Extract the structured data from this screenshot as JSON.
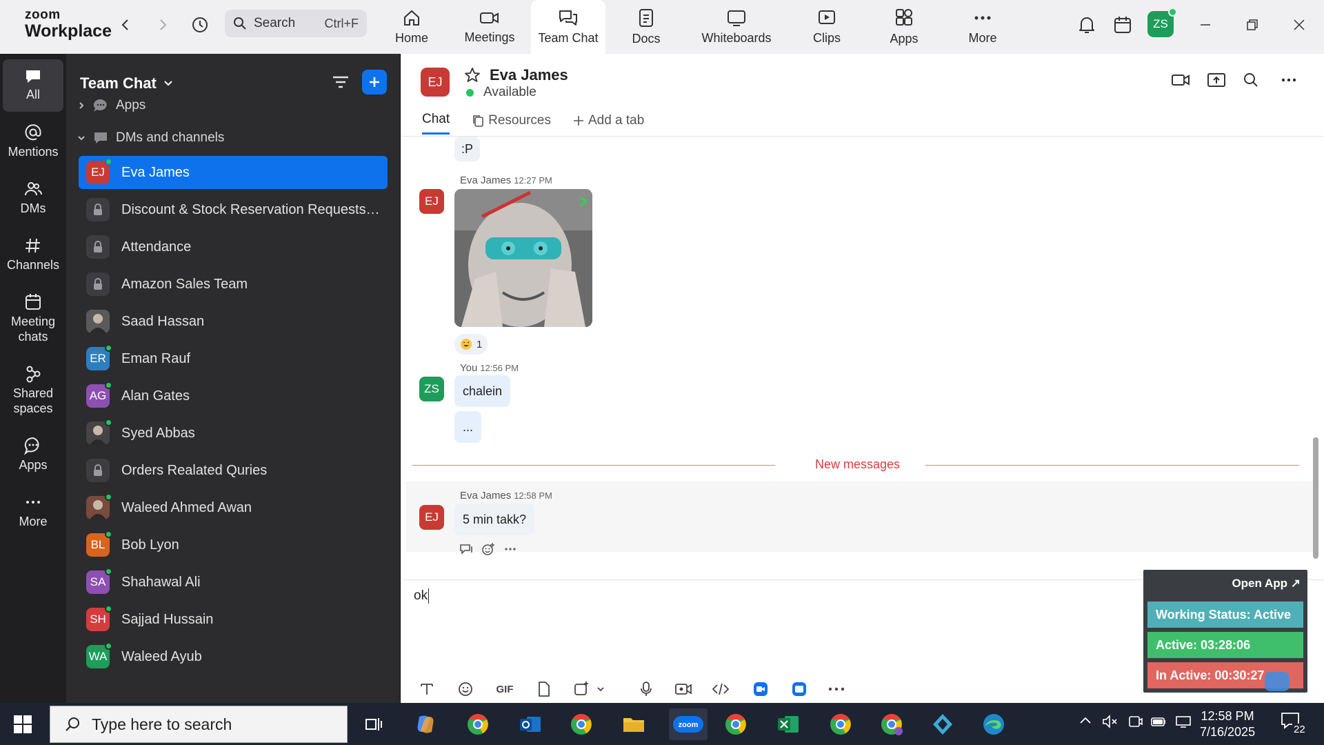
{
  "app": {
    "logo_line1": "zoom",
    "logo_line2": "Workplace",
    "search_placeholder": "Search",
    "search_shortcut": "Ctrl+F",
    "avatar_initials": "ZS"
  },
  "nav": [
    {
      "label": "Home",
      "icon": "home-icon"
    },
    {
      "label": "Meetings",
      "icon": "video-camera-icon"
    },
    {
      "label": "Team Chat",
      "icon": "chat-bubbles-icon",
      "active": true
    },
    {
      "label": "Docs",
      "icon": "document-icon"
    },
    {
      "label": "Whiteboards",
      "icon": "whiteboard-icon"
    },
    {
      "label": "Clips",
      "icon": "clips-icon"
    },
    {
      "label": "Apps",
      "icon": "apps-icon"
    },
    {
      "label": "More",
      "icon": "more-icon"
    }
  ],
  "rail": [
    {
      "label": "All",
      "icon": "chat-icon",
      "active": true
    },
    {
      "label": "Mentions",
      "icon": "at-icon"
    },
    {
      "label": "DMs",
      "icon": "people-icon"
    },
    {
      "label": "Channels",
      "icon": "hashtag-icon"
    },
    {
      "label": "Meeting chats",
      "icon": "calendar-icon"
    },
    {
      "label": "Shared spaces",
      "icon": "shared-spaces-icon"
    },
    {
      "label": "Apps",
      "icon": "apps-chat-icon"
    },
    {
      "label": "More",
      "icon": "more-icon"
    }
  ],
  "list": {
    "title": "Team Chat",
    "sections": {
      "apps": "Apps",
      "dms": "DMs and channels"
    },
    "items": [
      {
        "name": "Eva James",
        "type": "avatar",
        "initials": "EJ",
        "color": "#c83a34",
        "online": true,
        "active": true
      },
      {
        "name": "Discount & Stock Reservation Requests O...",
        "type": "lock"
      },
      {
        "name": "Attendance",
        "type": "lock"
      },
      {
        "name": "Amazon Sales Team",
        "type": "lock"
      },
      {
        "name": "Saad Hassan",
        "type": "photo",
        "color": "#5a5a5a",
        "online": false
      },
      {
        "name": "Eman Rauf",
        "type": "avatar",
        "initials": "ER",
        "color": "#2b7fc0",
        "online": true
      },
      {
        "name": "Alan Gates",
        "type": "avatar",
        "initials": "AG",
        "color": "#8e4fb3",
        "online": true
      },
      {
        "name": "Syed Abbas",
        "type": "photo",
        "color": "#444444",
        "online": true
      },
      {
        "name": "Orders Realated Quries",
        "type": "lock"
      },
      {
        "name": "Waleed Ahmed Awan",
        "type": "photo",
        "color": "#7a4b3c",
        "online": true
      },
      {
        "name": "Bob Lyon",
        "type": "avatar",
        "initials": "BL",
        "color": "#d9641e",
        "online": true
      },
      {
        "name": "Shahawal Ali",
        "type": "avatar",
        "initials": "SA",
        "color": "#8e4fb3",
        "online": true
      },
      {
        "name": "Sajjad Hussain",
        "type": "avatar",
        "initials": "SH",
        "color": "#d63c3c",
        "online": true
      },
      {
        "name": "Waleed Ayub",
        "type": "avatar",
        "initials": "WA",
        "color": "#1f9c5a",
        "online": true
      }
    ]
  },
  "chat": {
    "contact_initials": "EJ",
    "contact_name": "Eva James",
    "contact_status": "Available",
    "tabs": {
      "chat": "Chat",
      "resources": "Resources",
      "add": "Add a tab"
    },
    "messages": {
      "top_text": ":P",
      "gif_sender": "Eva James",
      "gif_time": "12:27 PM",
      "reaction_count": "1",
      "you_initials": "ZS",
      "you_sender": "You",
      "you_time": "12:56 PM",
      "you_text1": "chalein",
      "you_text2": "...",
      "new_messages": "New messages",
      "last_sender": "Eva James",
      "last_time": "12:58 PM",
      "last_text": "5 min takk?"
    },
    "composer_value": "ok"
  },
  "widget": {
    "open_app": "Open App ↗",
    "working_status": "Working Status: Active",
    "active": "Active: 03:28:06",
    "inactive": "In Active: 00:30:27"
  },
  "taskbar": {
    "search_placeholder": "Type here to search",
    "time": "12:58 PM",
    "date": "7/16/2025",
    "notifications": "22"
  },
  "colors": {
    "accent": "#0e72ed",
    "online": "#22c55e",
    "new_messages": "#d43f3f",
    "widget_status": "#4fb0b7",
    "widget_active": "#3fbf6b",
    "widget_inactive": "#e0665f"
  }
}
